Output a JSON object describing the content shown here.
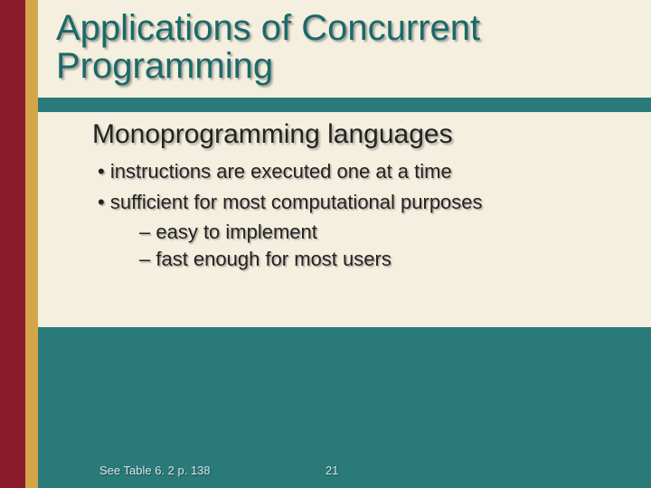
{
  "title": "Applications of Concurrent Programming",
  "subheading": "Monoprogramming languages",
  "bullets": [
    {
      "text": "instructions are executed one at a time",
      "children": []
    },
    {
      "text": "sufficient for most computational purposes",
      "children": [
        "easy to implement",
        "fast enough for most users"
      ]
    }
  ],
  "footer": {
    "note": "See Table 6. 2 p. 138",
    "page": "21"
  }
}
